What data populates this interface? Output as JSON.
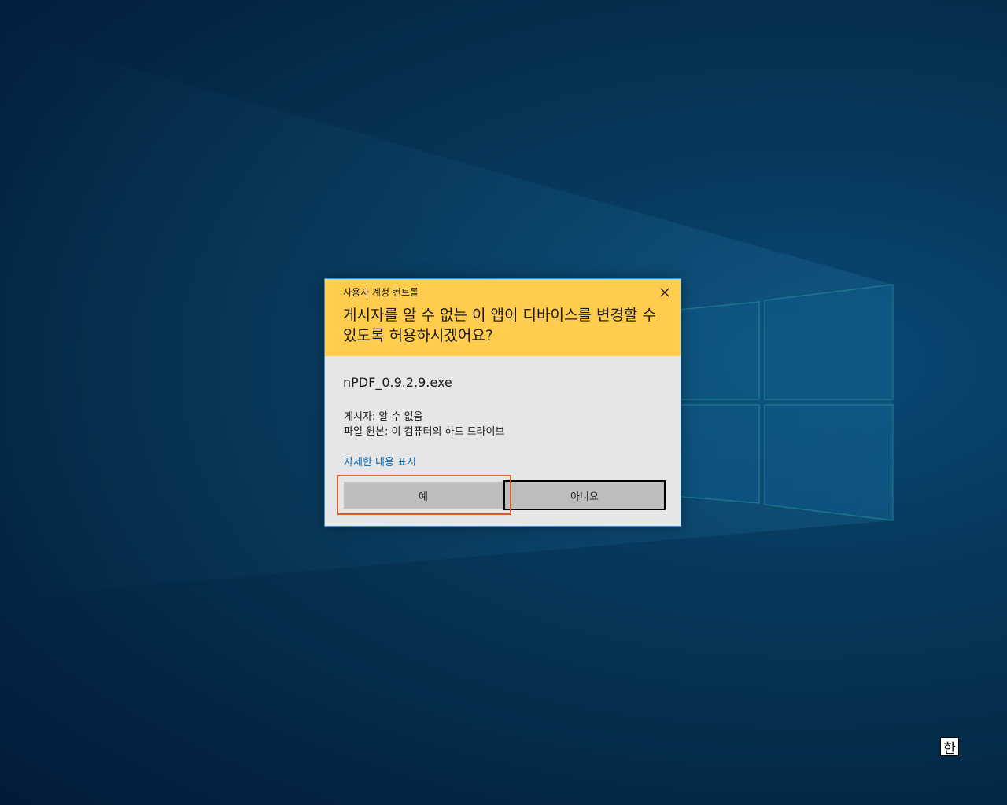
{
  "uac_dialog": {
    "caption": "사용자 계정 컨트롤",
    "question": "게시자를 알 수 없는 이 앱이 디바이스를 변경할 수 있도록 허용하시겠어요?",
    "program_name": "nPDF_0.9.2.9.exe",
    "publisher": "게시자: 알 수 없음",
    "file_origin": "파일 원본: 이 컴퓨터의 하드 드라이브",
    "details_link": "자세한 내용 표시",
    "yes_button": "예",
    "no_button": "아니요",
    "header_color": "#ffcc4d",
    "link_color": "#0067b8"
  },
  "taskbar_tray": {
    "ime_mode": "한"
  },
  "icons": {
    "close": "close-icon"
  },
  "colors": {
    "highlight": "#e0592a",
    "dialog_border": "#3a8fd6"
  }
}
